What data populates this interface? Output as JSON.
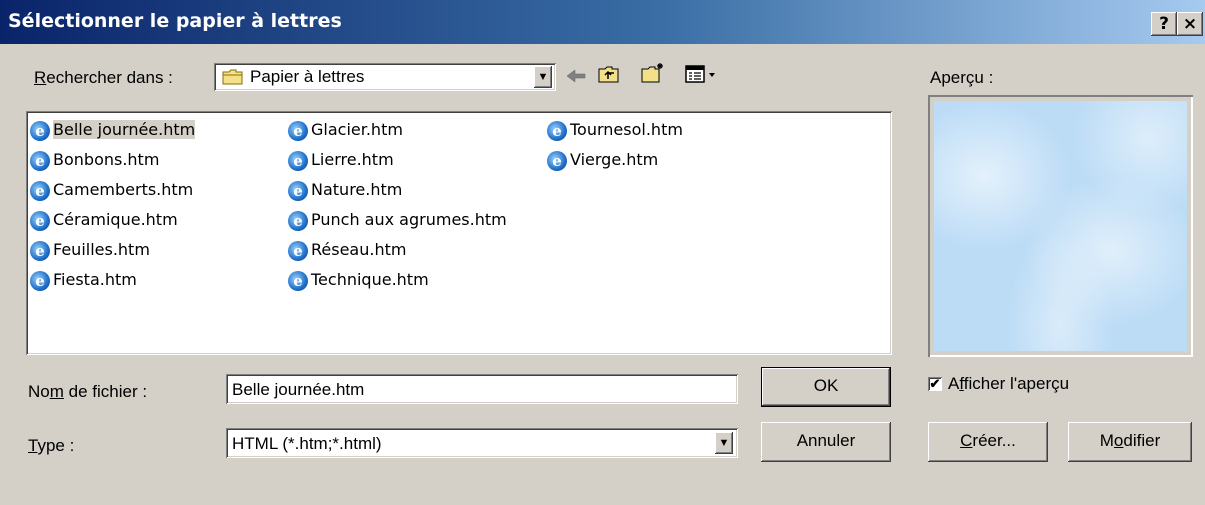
{
  "window": {
    "title": "Sélectionner le papier à lettres",
    "help_button": "?",
    "close_button": "×"
  },
  "lookin": {
    "label_accel": "R",
    "label_rest": "echercher dans :",
    "value": "Papier à lettres"
  },
  "toolbar": {
    "back_icon": "back-arrow-icon",
    "up_icon": "up-folder-icon",
    "newfolder_icon": "new-folder-icon",
    "view_icon": "view-menu-icon"
  },
  "files": {
    "columns": [
      [
        "Belle journée.htm",
        "Bonbons.htm",
        "Camemberts.htm",
        "Céramique.htm",
        "Feuilles.htm",
        "Fiesta.htm"
      ],
      [
        "Glacier.htm",
        "Lierre.htm",
        "Nature.htm",
        "Punch aux agrumes.htm",
        "Réseau.htm",
        "Technique.htm"
      ],
      [
        "Tournesol.htm",
        "Vierge.htm"
      ]
    ],
    "selected": "Belle journée.htm"
  },
  "preview": {
    "label": "Aperçu :",
    "show_checkbox_accel_before": "A",
    "show_checkbox_accel": "f",
    "show_checkbox_rest": "ficher l'aperçu",
    "show_checked": true
  },
  "filename": {
    "label_before": "No",
    "label_accel": "m",
    "label_after": " de fichier :",
    "value": "Belle journée.htm"
  },
  "type": {
    "label_accel": "T",
    "label_rest": "ype :",
    "value": "HTML (*.htm;*.html)"
  },
  "buttons": {
    "ok": "OK",
    "cancel": "Annuler",
    "create_accel": "C",
    "create_rest": "réer...",
    "modify_before": "M",
    "modify_accel": "o",
    "modify_rest": "difier"
  },
  "colors": {
    "title_start": "#0a246a",
    "title_end": "#a6caf0",
    "face": "#d4d0c8"
  }
}
